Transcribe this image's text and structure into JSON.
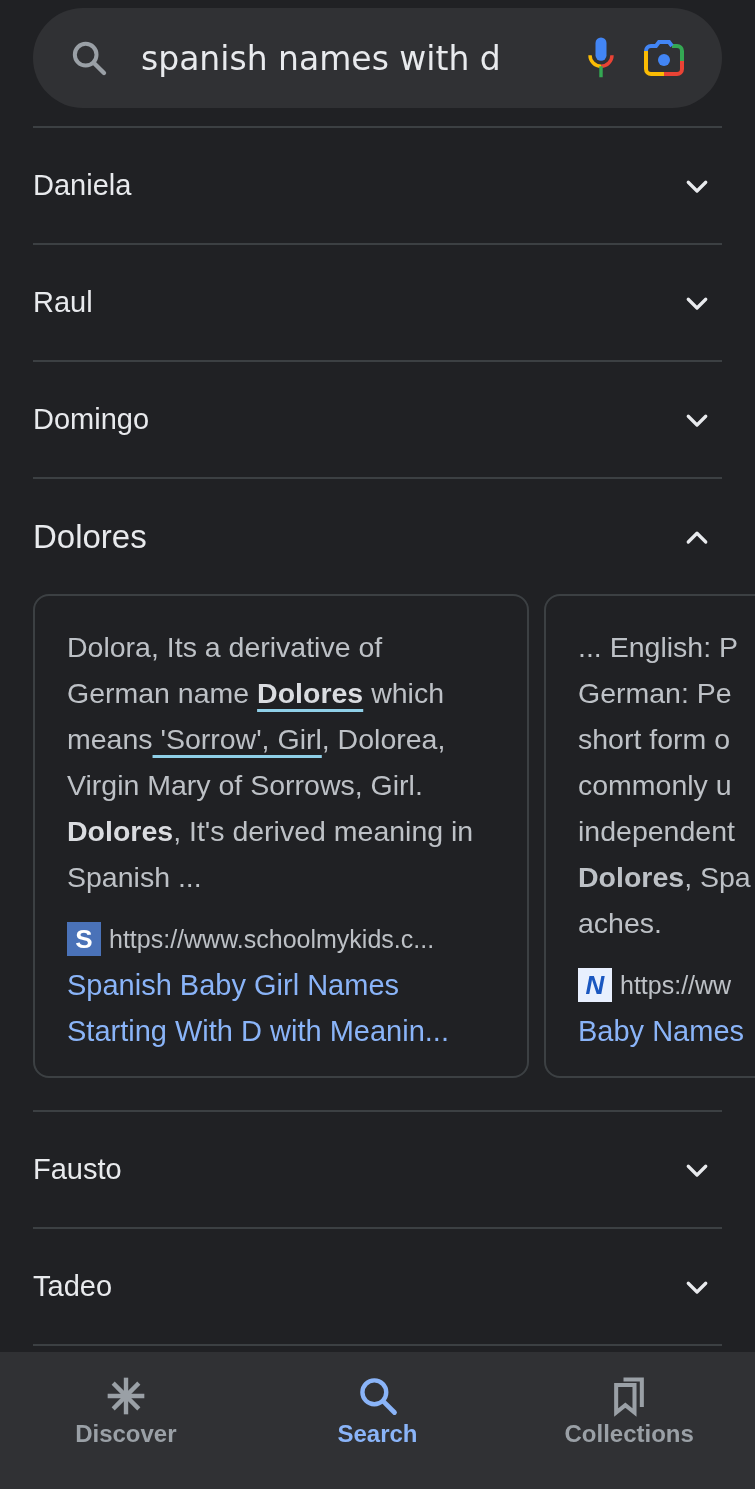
{
  "search": {
    "value": "spanish names with d"
  },
  "items": [
    {
      "name": "Daniela",
      "expanded": false
    },
    {
      "name": "Raul",
      "expanded": false
    },
    {
      "name": "Domingo",
      "expanded": false
    },
    {
      "name": "Dolores",
      "expanded": true,
      "cards": [
        {
          "segments": [
            {
              "text": "Dolora, Its a derivative of German name ",
              "bold": false,
              "underlined": false
            },
            {
              "text": "Dolores",
              "bold": true,
              "underlined": true
            },
            {
              "text": " which means",
              "bold": false,
              "underlined": false
            },
            {
              "text": " 'Sorrow', Girl",
              "bold": false,
              "underlined": true
            },
            {
              "text": ", Dolorea, Virgin Mary of Sorrows, Girl. ",
              "bold": false,
              "underlined": false
            },
            {
              "text": "Dolores",
              "bold": true,
              "underlined": false
            },
            {
              "text": ", It's derived meaning in Spanish ...",
              "bold": false,
              "underlined": false
            }
          ],
          "url": "https://www.schoolmykids.c...",
          "favicon": "S",
          "title": "Spanish Baby Girl Names Starting With D with Meanin..."
        },
        {
          "lines": [
            "... English: P",
            "German: Pe",
            "short form o",
            "commonly u",
            "independent",
            "**Dolores**, Spa",
            "aches."
          ],
          "url": "https://ww",
          "favicon": "N",
          "title": "Baby Names"
        }
      ]
    },
    {
      "name": "Fausto",
      "expanded": false
    },
    {
      "name": "Tadeo",
      "expanded": false
    }
  ],
  "nav": [
    {
      "label": "Discover",
      "kind": "discover",
      "selected": false
    },
    {
      "label": "Search",
      "kind": "search",
      "selected": true
    },
    {
      "label": "Collections",
      "kind": "collections",
      "selected": false
    }
  ]
}
